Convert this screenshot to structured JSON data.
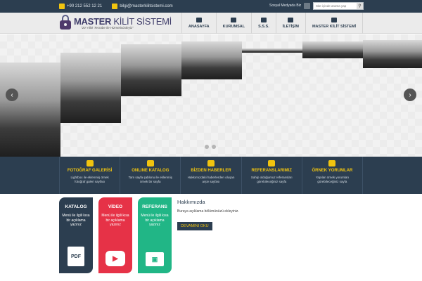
{
  "topbar": {
    "phone": "+90 212 552 12 21",
    "email": "bilgi@masterkilitsistemi.com",
    "social_label": "Sosyal Medyada Biz",
    "search_placeholder": "Site içinde arama yap",
    "search_icon": "magnifier-icon"
  },
  "logo": {
    "name_bold": "MASTER",
    "name_light": "KİLİT SİSTEMİ",
    "slogan": "\"20 Yıllık Tecrübe ile Hizmetinizdeyiz\""
  },
  "nav": {
    "items": [
      {
        "label": "ANASAYFA",
        "icon": "home-icon"
      },
      {
        "label": "KURUMSAL",
        "icon": "users-icon"
      },
      {
        "label": "S.S.S.",
        "icon": "question-icon"
      },
      {
        "label": "İLETİŞİM",
        "icon": "envelope-icon"
      },
      {
        "label": "MASTER KİLİT SİSTEMİ",
        "icon": "chevron-right-icon"
      }
    ]
  },
  "slider": {
    "prev": "‹",
    "next": "›"
  },
  "features": [
    {
      "title": "FOTOĞRAF GALERİSİ",
      "desc": "Lightbox ile eklenmiş örnek fotoğraf galeri sayfası",
      "icon": "camera-icon"
    },
    {
      "title": "ONLINE KATALOG",
      "desc": "Tam sayfa şablonu ile eklenmiş örnek bir sayfa",
      "icon": "pdf-icon"
    },
    {
      "title": "BİZDEN HABERLER",
      "desc": "Hakkımızdaki haberlerden oluşan arşiv sayfası",
      "icon": "globe-icon"
    },
    {
      "title": "REFERANSLARIMIZ",
      "desc": "Sahip olduğumuz referansları görebileceğiniz sayfa",
      "icon": "handshake-icon"
    },
    {
      "title": "ÖRNEK YORUMLAR",
      "desc": "Yapılan örnek yorumları görebileceğiniz sayfa",
      "icon": "comments-icon"
    }
  ],
  "cards": [
    {
      "title": "KATALOG",
      "desc": "Menü ile ilgili kısa bir açıklama yazınız",
      "icon_label": "PDF",
      "color": "#2c3e50"
    },
    {
      "title": "VİDEO",
      "desc": "Menü ile ilgili kısa bir açıklama yazınız",
      "icon_label": "▶",
      "color": "#e63247"
    },
    {
      "title": "REFERANS",
      "desc": "Menü ile ilgili kısa bir açıklama yazınız",
      "icon_label": "▣",
      "color": "#21b686"
    }
  ],
  "about": {
    "title": "Hakkımızda",
    "text": "Buraya açıklama bölümünüzü ekleyiniz.",
    "button": "DEVAMINI OKU"
  },
  "colors": {
    "navy": "#2c3e50",
    "accent": "#f1c40f",
    "red": "#e63247",
    "green": "#21b686"
  }
}
